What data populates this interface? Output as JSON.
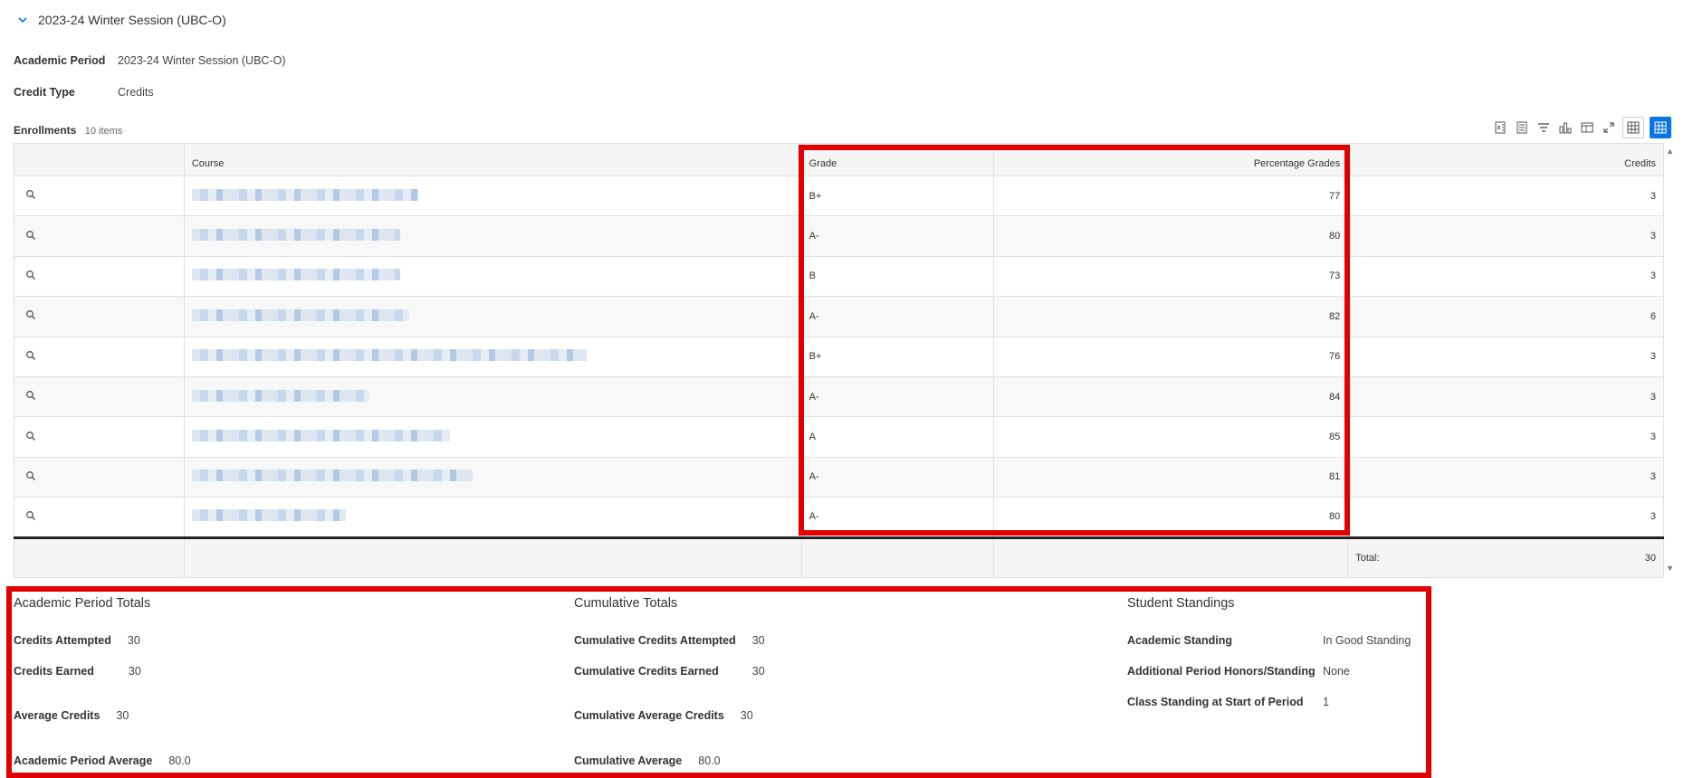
{
  "session": {
    "title": "2023-24 Winter Session (UBC-O)"
  },
  "fields": [
    {
      "label": "Academic Period",
      "value": "2023-24 Winter Session (UBC-O)"
    },
    {
      "label": "Credit Type",
      "value": "Credits"
    }
  ],
  "enrollments": {
    "label": "Enrollments",
    "count": "10 items",
    "columns": [
      "Course",
      "Grade",
      "Percentage Grades",
      "Credits"
    ],
    "rows": [
      {
        "grade": "B+",
        "percent": "77",
        "credits": "3"
      },
      {
        "grade": "A-",
        "percent": "80",
        "credits": "3"
      },
      {
        "grade": "B",
        "percent": "73",
        "credits": "3"
      },
      {
        "grade": "A-",
        "percent": "82",
        "credits": "6"
      },
      {
        "grade": "B+",
        "percent": "76",
        "credits": "3"
      },
      {
        "grade": "A-",
        "percent": "84",
        "credits": "3"
      },
      {
        "grade": "A",
        "percent": "85",
        "credits": "3"
      },
      {
        "grade": "A-",
        "percent": "81",
        "credits": "3"
      },
      {
        "grade": "A-",
        "percent": "80",
        "credits": "3"
      }
    ],
    "total_label": "Total:",
    "total_value": "30"
  },
  "period_totals": {
    "title": "Academic Period Totals",
    "items": [
      {
        "label": "Credits Attempted",
        "value": "30"
      },
      {
        "label": "Credits Earned",
        "value": "30"
      },
      {
        "label": "Average Credits",
        "value": "30"
      },
      {
        "label": "Academic Period Average",
        "value": "80.0"
      }
    ]
  },
  "cumulative_totals": {
    "title": "Cumulative Totals",
    "items": [
      {
        "label": "Cumulative Credits Attempted",
        "value": "30"
      },
      {
        "label": "Cumulative Credits Earned",
        "value": "30"
      },
      {
        "label": "Cumulative Average Credits",
        "value": "30"
      },
      {
        "label": "Cumulative Average",
        "value": "80.0"
      }
    ]
  },
  "student_standings": {
    "title": "Student Standings",
    "items": [
      {
        "label": "Academic Standing",
        "value": "In Good Standing"
      },
      {
        "label": "Additional Period Honors/Standing",
        "value": "None"
      },
      {
        "label": "Class Standing at Start of Period",
        "value": "1"
      }
    ]
  },
  "icons": [
    "chevron-down-icon",
    "export-excel-icon",
    "export-pdf-icon",
    "filter-icon",
    "chart-icon",
    "column-layout-icon",
    "fullscreen-icon",
    "table-view-icon",
    "grid-view-icon",
    "magnifier-icon"
  ],
  "colors": {
    "accent": "#0875e1",
    "highlight": "#e00000",
    "header_bg": "#f5f5f5"
  }
}
